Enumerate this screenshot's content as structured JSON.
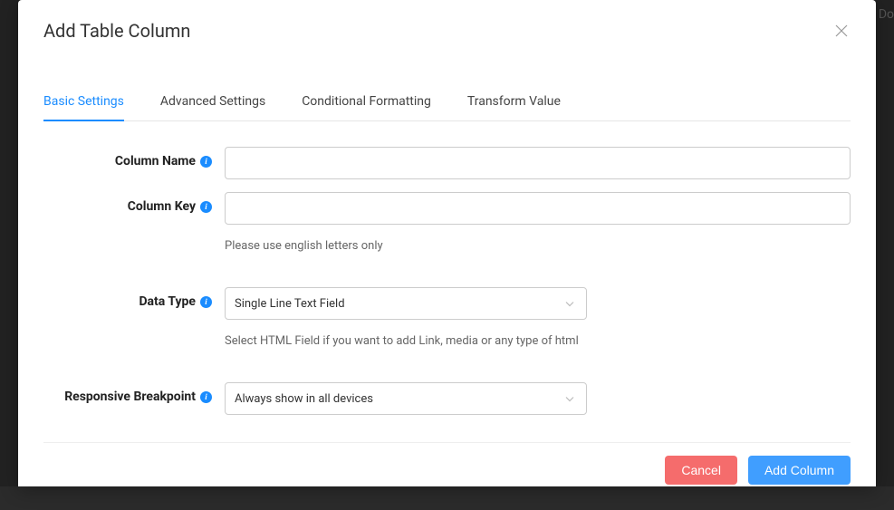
{
  "modal": {
    "title": "Add Table Column"
  },
  "tabs": [
    {
      "label": "Basic Settings",
      "active": true
    },
    {
      "label": "Advanced Settings",
      "active": false
    },
    {
      "label": "Conditional Formatting",
      "active": false
    },
    {
      "label": "Transform Value",
      "active": false
    }
  ],
  "fields": {
    "columnName": {
      "label": "Column Name",
      "value": ""
    },
    "columnKey": {
      "label": "Column Key",
      "value": "",
      "help": "Please use english letters only"
    },
    "dataType": {
      "label": "Data Type",
      "value": "Single Line Text Field",
      "help": "Select HTML Field if you want to add Link, media or any type of html"
    },
    "responsiveBreakpoint": {
      "label": "Responsive Breakpoint",
      "value": "Always show in all devices"
    }
  },
  "buttons": {
    "cancel": "Cancel",
    "add": "Add Column"
  },
  "bg": {
    "doFragment": "Do"
  }
}
